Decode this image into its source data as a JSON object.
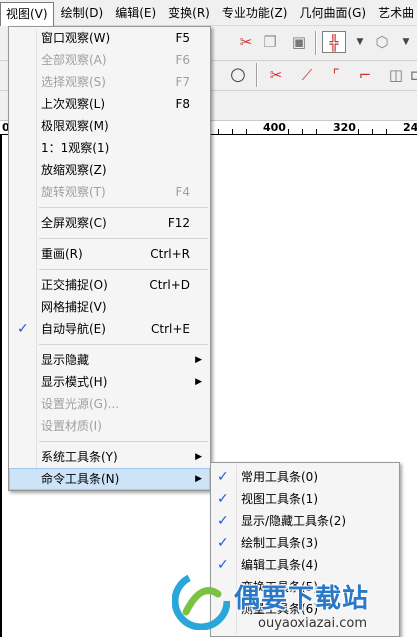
{
  "menubar": {
    "items": [
      "视图(V)",
      "绘制(D)",
      "编辑(E)",
      "变换(R)",
      "专业功能(Z)",
      "几何曲面(G)",
      "艺术曲"
    ]
  },
  "ruler": {
    "labels": [
      "0",
      "400",
      "320",
      "24"
    ]
  },
  "view_menu": {
    "items": [
      {
        "label": "窗口观察(W)",
        "shortcut": "F5",
        "enabled": true,
        "checked": false
      },
      {
        "label": "全部观察(A)",
        "shortcut": "F6",
        "enabled": false,
        "checked": false
      },
      {
        "label": "选择观察(S)",
        "shortcut": "F7",
        "enabled": false,
        "checked": false
      },
      {
        "label": "上次观察(L)",
        "shortcut": "F8",
        "enabled": true,
        "checked": false
      },
      {
        "label": "极限观察(M)",
        "shortcut": "",
        "enabled": true,
        "checked": false
      },
      {
        "label": "1：1观察(1)",
        "shortcut": "",
        "enabled": true,
        "checked": false
      },
      {
        "label": "放缩观察(Z)",
        "shortcut": "",
        "enabled": true,
        "checked": false
      },
      {
        "label": "旋转观察(T)",
        "shortcut": "F4",
        "enabled": false,
        "checked": false
      },
      {
        "separator": true
      },
      {
        "label": "全屏观察(C)",
        "shortcut": "F12",
        "enabled": true,
        "checked": false
      },
      {
        "separator": true
      },
      {
        "label": "重画(R)",
        "shortcut": "Ctrl+R",
        "enabled": true,
        "checked": false
      },
      {
        "separator": true
      },
      {
        "label": "正交捕捉(O)",
        "shortcut": "Ctrl+D",
        "enabled": true,
        "checked": false
      },
      {
        "label": "网格捕捉(V)",
        "shortcut": "",
        "enabled": true,
        "checked": false
      },
      {
        "label": "自动导航(E)",
        "shortcut": "Ctrl+E",
        "enabled": true,
        "checked": true
      },
      {
        "separator": true
      },
      {
        "label": "显示隐藏",
        "shortcut": "",
        "enabled": true,
        "checked": false,
        "submenu": true
      },
      {
        "label": "显示模式(H)",
        "shortcut": "",
        "enabled": true,
        "checked": false,
        "submenu": true
      },
      {
        "label": "设置光源(G)...",
        "shortcut": "",
        "enabled": false,
        "checked": false
      },
      {
        "label": "设置材质(I)",
        "shortcut": "",
        "enabled": false,
        "checked": false
      },
      {
        "separator": true
      },
      {
        "label": "系统工具条(Y)",
        "shortcut": "",
        "enabled": true,
        "checked": false,
        "submenu": true
      },
      {
        "label": "命令工具条(N)",
        "shortcut": "",
        "enabled": true,
        "checked": false,
        "submenu": true,
        "highlighted": true
      }
    ]
  },
  "command_toolbar_menu": {
    "items": [
      {
        "label": "常用工具条(0)",
        "checked": true
      },
      {
        "label": "视图工具条(1)",
        "checked": true
      },
      {
        "label": "显示/隐藏工具条(2)",
        "checked": true
      },
      {
        "label": "绘制工具条(3)",
        "checked": true
      },
      {
        "label": "编辑工具条(4)",
        "checked": true
      },
      {
        "label": "变换工具条(5)",
        "checked": false
      },
      {
        "label": "测量工具条(6)",
        "checked": false
      }
    ]
  },
  "watermark": {
    "title": "偶要下载站",
    "url": "ouyaoxiazai.com"
  },
  "colors": {
    "highlight": "#cde3f8",
    "check": "#1e5bd6",
    "watermark": "#2a78c8"
  }
}
